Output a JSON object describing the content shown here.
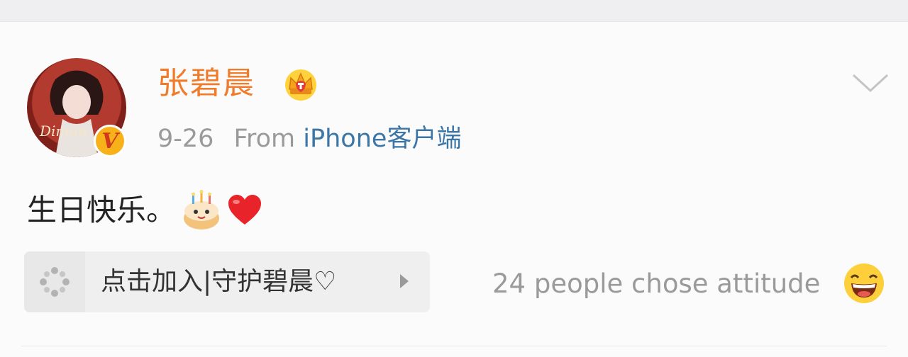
{
  "post": {
    "author": {
      "name": "张碧晨",
      "avatar_icon": "user-avatar",
      "verified_icon": "verified-v-icon",
      "verified_letter": "V",
      "member_icon": "crown-icon"
    },
    "meta": {
      "date": "9-26",
      "source_prefix": "From",
      "source_link": "iPhone客户端"
    },
    "text": "生日快乐。",
    "emojis": [
      "birthday-cake-emoji",
      "red-heart-emoji"
    ],
    "menu_icon": "chevron-down-icon",
    "group_bar": {
      "icon": "loading-dots-icon",
      "label": "点击加入|守护碧晨♡",
      "arrow_icon": "play-arrow-icon"
    },
    "attitude": {
      "text": "24 people chose attitude",
      "icon": "laughing-face-emoji"
    }
  },
  "colors": {
    "username": "#f07b2a",
    "link": "#3b76a6",
    "meta_gray": "#9a9a9a",
    "text": "#222222",
    "badge": "#f7b21a"
  }
}
